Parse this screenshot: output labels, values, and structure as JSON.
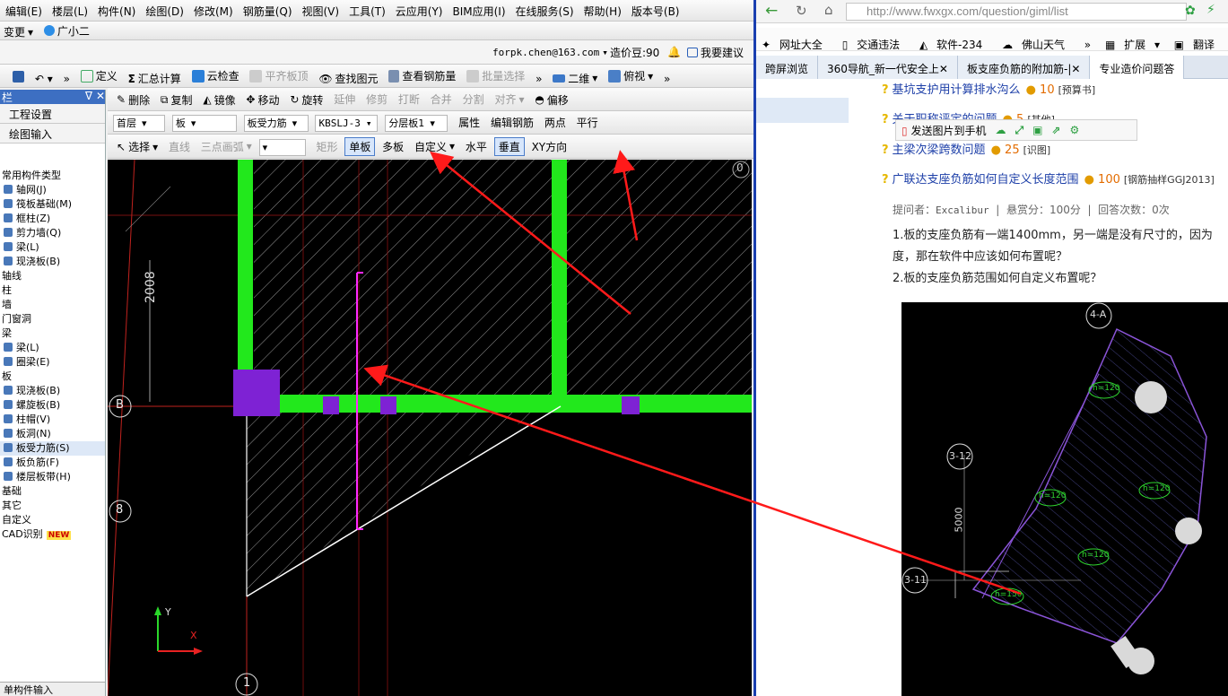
{
  "app": {
    "menu": [
      "编辑(E)",
      "楼层(L)",
      "构件(N)",
      "绘图(D)",
      "修改(M)",
      "钢筋量(Q)",
      "视图(V)",
      "工具(T)",
      "云应用(Y)",
      "BIM应用(I)",
      "在线服务(S)",
      "帮助(H)",
      "版本号(B)"
    ],
    "row2_left": "变更",
    "row2_user": "广小二",
    "account": "forpk.chen@163.com",
    "price_label": "造价豆:90",
    "suggest": "我要建议",
    "toolbar1": {
      "define": "定义",
      "sum": "汇总计算",
      "cloud_check": "云检查",
      "flat_top": "平齐板顶",
      "find": "查找图元",
      "view_rebar": "查看钢筋量",
      "batch_select": "批量选择",
      "view_2d": "二维",
      "view_mode": "俯视"
    },
    "toolbar2": {
      "delete": "删除",
      "copy": "复制",
      "mirror": "镜像",
      "move": "移动",
      "rotate": "旋转",
      "extend": "延伸",
      "trim": "修剪",
      "break": "打断",
      "merge": "合并",
      "split": "分割",
      "align": "对齐",
      "offset": "偏移"
    },
    "toolbar3": {
      "floor": "首层",
      "category": "板",
      "subcategory": "板受力筋",
      "code": "KBSLJ-3",
      "layer": "分层板1",
      "props": "属性",
      "edit_rebar": "编辑钢筋",
      "two_point": "两点",
      "parallel": "平行"
    },
    "toolbar4": {
      "select": "选择",
      "line": "直线",
      "arc": "三点画弧",
      "rect": "矩形",
      "single": "单板",
      "multi": "多板",
      "custom": "自定义",
      "horizontal": "水平",
      "vertical": "垂直",
      "xy": "XY方向"
    },
    "side": {
      "header": "栏",
      "tabs": [
        "工程设置",
        "绘图输入"
      ],
      "tree": [
        {
          "level": 1,
          "label": "常用构件类型"
        },
        {
          "level": 2,
          "label": "轴网(J)"
        },
        {
          "level": 2,
          "label": "筏板基础(M)"
        },
        {
          "level": 2,
          "label": "框柱(Z)"
        },
        {
          "level": 2,
          "label": "剪力墙(Q)"
        },
        {
          "level": 2,
          "label": "梁(L)"
        },
        {
          "level": 2,
          "label": "现浇板(B)"
        },
        {
          "level": 1,
          "label": "轴线"
        },
        {
          "level": 1,
          "label": "柱"
        },
        {
          "level": 1,
          "label": "墙"
        },
        {
          "level": 1,
          "label": "门窗洞"
        },
        {
          "level": 1,
          "label": "梁"
        },
        {
          "level": 2,
          "label": "梁(L)"
        },
        {
          "level": 2,
          "label": "圈梁(E)"
        },
        {
          "level": 1,
          "label": "板"
        },
        {
          "level": 2,
          "label": "现浇板(B)"
        },
        {
          "level": 2,
          "label": "螺旋板(B)"
        },
        {
          "level": 2,
          "label": "柱帽(V)"
        },
        {
          "level": 2,
          "label": "板洞(N)"
        },
        {
          "level": 2,
          "label": "板受力筋(S)",
          "selected": true
        },
        {
          "level": 2,
          "label": "板负筋(F)"
        },
        {
          "level": 2,
          "label": "楼层板带(H)"
        },
        {
          "level": 1,
          "label": "基础"
        },
        {
          "level": 1,
          "label": "其它"
        },
        {
          "level": 1,
          "label": "自定义"
        },
        {
          "level": 1,
          "label": "CAD识别",
          "badge": "NEW"
        }
      ],
      "footer": "单构件输入"
    },
    "canvas": {
      "dimension": "2008",
      "axis_b": "B",
      "axis_8": "8",
      "axis_1": "1",
      "y_label": "Y",
      "x_label": "X",
      "corner": "0"
    }
  },
  "browser": {
    "url": "http://www.fwxgx.com/question/giml/list",
    "bookmarks": [
      "网址大全",
      "交通违法",
      "软件-234",
      "佛山天气",
      "扩展",
      "翻译"
    ],
    "tabs": [
      "跨屏浏览",
      "360导航_新一代安全上",
      "板支座负筋的附加筋-|",
      "专业造价问题答"
    ],
    "questions": [
      {
        "title": "基坑支护用计算排水沟么",
        "reward": "10",
        "category": "[预算书]"
      },
      {
        "title": "关于职称评定的问题",
        "reward": "5",
        "category": "[其他]"
      },
      {
        "title": "主梁次梁跨数问题",
        "reward": "25",
        "category": "[识图]"
      },
      {
        "title": "广联达支座负筋如何自定义长度范围",
        "reward": "100",
        "category": "[钢筋抽样GGJ2013]"
      }
    ],
    "share_bar": "发送图片到手机",
    "asker_label": "提问者：",
    "asker": "Excalibur",
    "bounty": "悬赏分：100分",
    "answers": "回答次数：0次",
    "question_lines": [
      "1.板的支座负筋有一端1400mm，另一端是没有尺寸的，因为",
      "度，那在软件中应该如何布置呢？",
      "2.板的支座负筋范围如何自定义布置呢？"
    ],
    "drawing_labels": [
      "4-A",
      "3-12",
      "3-11",
      "5000",
      "h=120",
      "h=120",
      "h=120",
      "h=120",
      "h=150"
    ]
  }
}
